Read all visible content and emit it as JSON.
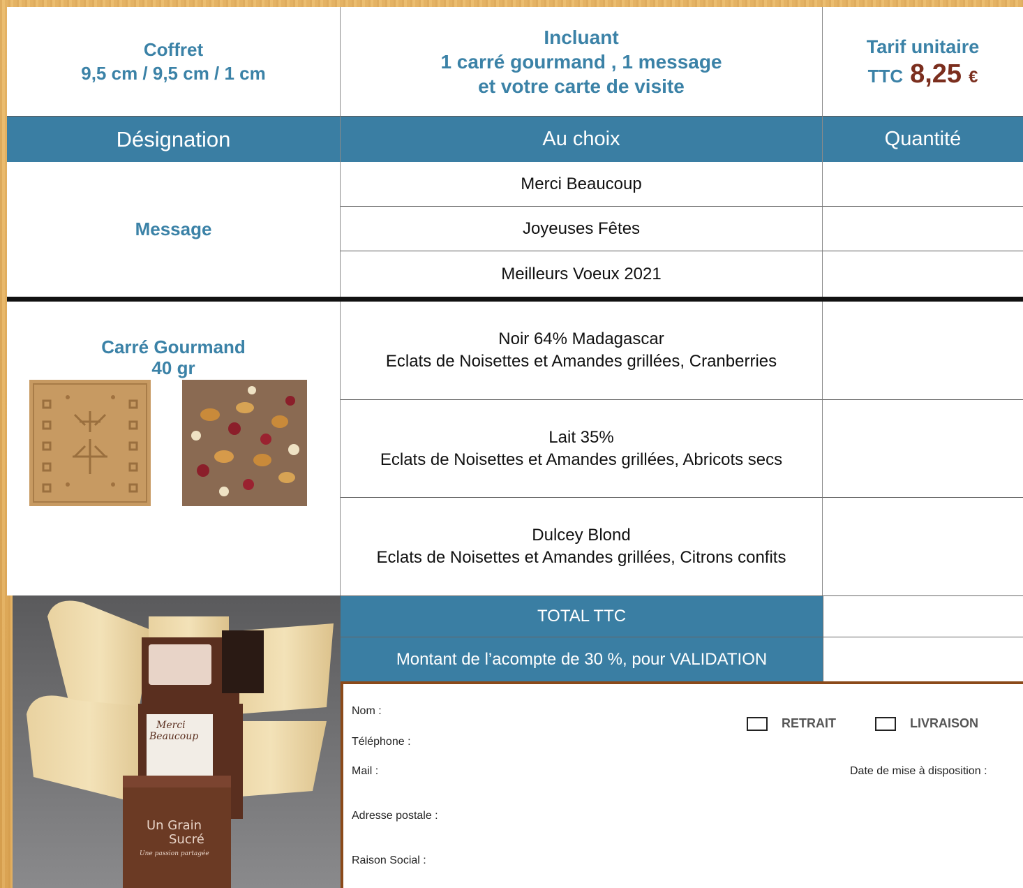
{
  "header": {
    "coffret_title": "Coffret",
    "coffret_dims": "9,5 cm / 9,5 cm / 1 cm",
    "incl_line1": "Incluant",
    "incl_line2": "1 carré gourmand , 1 message",
    "incl_line3": "et votre carte de visite",
    "tarif_title": "Tarif unitaire",
    "ttc_label": "TTC",
    "price": "8,25",
    "currency": "€"
  },
  "columns": {
    "designation": "Désignation",
    "choix": "Au choix",
    "quantite": "Quantité"
  },
  "message_section": {
    "label": "Message",
    "options": [
      "Merci Beaucoup",
      "Joyeuses Fêtes",
      "Meilleurs Voeux 2021"
    ]
  },
  "carre_section": {
    "label_line1": "Carré Gourmand",
    "label_line2": "40 gr",
    "options": [
      {
        "line1": "Noir 64% Madagascar",
        "line2": "Eclats de Noisettes et Amandes grillées, Cranberries"
      },
      {
        "line1": "Lait 35%",
        "line2": "Eclats de Noisettes et Amandes grillées, Abricots secs"
      },
      {
        "line1": "Dulcey Blond",
        "line2": "Eclats de Noisettes et Amandes grillées, Citrons confits"
      }
    ]
  },
  "totals": {
    "total_label": "TOTAL TTC",
    "acompte_label": "Montant de l’acompte de 30 %, pour VALIDATION"
  },
  "form": {
    "nom": "Nom :",
    "telephone": "Téléphone :",
    "mail": "Mail :",
    "adresse": "Adresse postale :",
    "raison": "Raison Social :",
    "retrait": "RETRAIT",
    "livraison": "LIVRAISON",
    "date": "Date de mise à disposition :"
  },
  "product_photo": {
    "brand_top": "Un Grain",
    "brand_bottom": "Sucré",
    "tagline": "Une passion partagée",
    "card_text_1": "Merci",
    "card_text_2": "Beaucoup"
  },
  "colors": {
    "accent_blue": "#3a7ea3",
    "price_brown": "#7b2e1e",
    "wood": "#dca656"
  }
}
